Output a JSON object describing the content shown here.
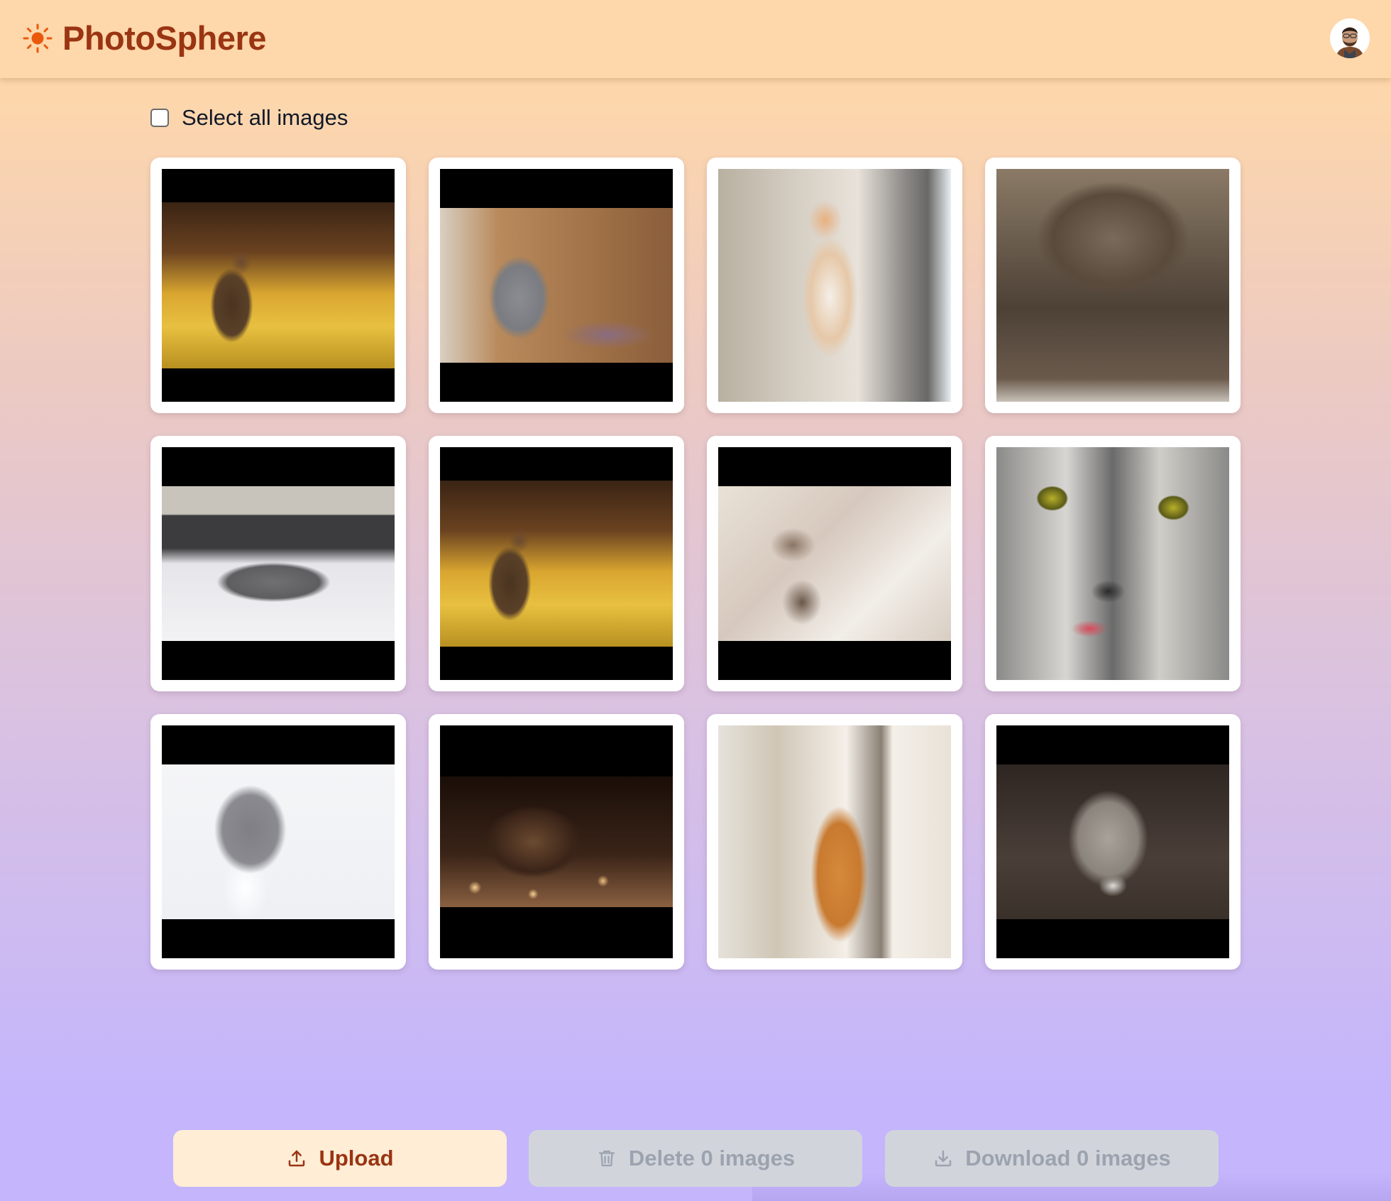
{
  "header": {
    "app_title": "PhotoSphere",
    "logo_icon": "sun-icon",
    "avatar_alt": "User avatar"
  },
  "selection": {
    "select_all_label": "Select all images",
    "checked": false
  },
  "colors": {
    "brand_text": "#9A3412",
    "brand_icon": "#EA580C",
    "header_bg": "#FED7AA",
    "bg_gradient_top": "#FED7AA",
    "bg_gradient_bottom": "#C4B5FD",
    "upload_bg": "#FFEDD5",
    "disabled_bg": "#D1D5DB",
    "disabled_text": "#9CA3AF"
  },
  "gallery": {
    "images": [
      {
        "subject": "tabby kitten in sunlit yellow grass",
        "letterboxed": true,
        "palette": [
          "#3a2414",
          "#8a5a20",
          "#e2b430",
          "#c9a22a"
        ]
      },
      {
        "subject": "grey scottish fold kitten",
        "letterboxed": true,
        "palette": [
          "#caa27a",
          "#9e6f45",
          "#7d7f86",
          "#6d5a5e"
        ]
      },
      {
        "subject": "orange and white cat looking up by window",
        "letterboxed": false,
        "palette": [
          "#c9c0b4",
          "#efe9e2",
          "#d99a5a",
          "#8d8b88"
        ]
      },
      {
        "subject": "grumpy tabby cat",
        "letterboxed": false,
        "palette": [
          "#7a6a5a",
          "#4d4136",
          "#8a7a66",
          "#d9d0c8"
        ]
      },
      {
        "subject": "grey cat lying on white bed",
        "letterboxed": true,
        "palette": [
          "#c8c4bc",
          "#3c3c3e",
          "#f0eff0",
          "#6f6e70"
        ]
      },
      {
        "subject": "tabby kitten in sunlit yellow grass",
        "letterboxed": true,
        "palette": [
          "#3a2414",
          "#8a5a20",
          "#e2b430",
          "#c9a22a"
        ]
      },
      {
        "subject": "kitten sleeping on back showing paws",
        "letterboxed": true,
        "palette": [
          "#e9e2d6",
          "#d6c8bd",
          "#7e6a5c",
          "#f2eee8"
        ]
      },
      {
        "subject": "close-up tabby cat with green eyes licking",
        "letterboxed": false,
        "palette": [
          "#9a9a98",
          "#3a3a3a",
          "#d8d6d2",
          "#b8b02a"
        ]
      },
      {
        "subject": "grey and white cat with yellow eyes",
        "letterboxed": true,
        "palette": [
          "#f4f5f7",
          "#7f7f85",
          "#ffffff",
          "#b8a25a"
        ]
      },
      {
        "subject": "cat among fairy lights",
        "letterboxed": true,
        "palette": [
          "#1a0e08",
          "#6b4a30",
          "#d8a060",
          "#3a2418"
        ]
      },
      {
        "subject": "orange tabby cat sitting by window",
        "letterboxed": false,
        "palette": [
          "#e6e2da",
          "#cfc6b6",
          "#d68a3a",
          "#f4efe8"
        ]
      },
      {
        "subject": "tabby cat looking up",
        "letterboxed": true,
        "palette": [
          "#2e2622",
          "#8a847c",
          "#c8c2ba",
          "#4a3e38"
        ]
      }
    ]
  },
  "actions": {
    "upload_label": "Upload",
    "delete_label": "Delete 0 images",
    "download_label": "Download 0 images",
    "selected_count": 0,
    "delete_enabled": false,
    "download_enabled": false
  }
}
